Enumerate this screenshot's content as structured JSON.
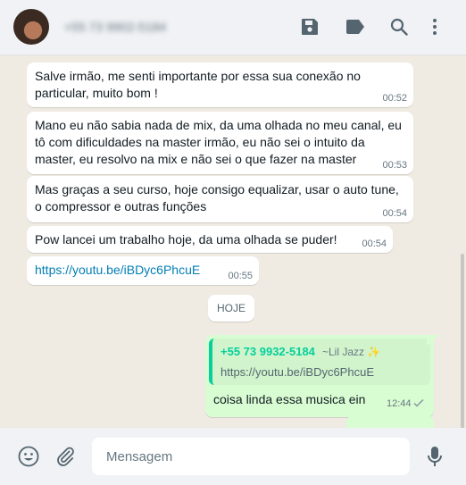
{
  "header": {
    "contact_name": "+55 73 9902-5184",
    "icons": [
      "save-icon",
      "label-icon",
      "search-icon",
      "menu-icon"
    ]
  },
  "messages": [
    {
      "text": "Salve irmão, me senti importante por essa sua conexão no particular, muito bom !",
      "time": "00:52"
    },
    {
      "text": "Mano eu não sabia nada de mix, da uma olhada no meu canal, eu tô com dificuldades na master irmão, eu não sei o intuito da master, eu resolvo na mix e não sei o que fazer na master",
      "time": "00:53"
    },
    {
      "text": "Mas graças a seu curso, hoje consigo equalizar, usar o auto tune, o compressor e outras funções",
      "time": "00:54"
    },
    {
      "text": "Pow lancei um trabalho hoje, da uma olhada se puder!",
      "time": "00:54"
    },
    {
      "text": "https://youtu.be/iBDyc6PhcuE",
      "time": "00:55"
    }
  ],
  "day_divider": "HOJE",
  "outgoing": {
    "quote_number": "+55 73 9932-5184",
    "quote_name": "~Lil Jazz ✨",
    "quote_text": "https://youtu.be/iBDyc6PhcuE",
    "text": "coisa linda essa musica ein",
    "time": "12:44",
    "status": "✓"
  },
  "composer": {
    "placeholder": "Mensagem",
    "icons": [
      "emoji-icon",
      "attach-icon",
      "mic-icon"
    ]
  },
  "colors": {
    "incoming_bg": "#ffffff",
    "outgoing_bg": "#d9fdd3",
    "quote_accent": "#06cf9c",
    "link": "#027eb5",
    "chat_bg": "#efeae2"
  }
}
